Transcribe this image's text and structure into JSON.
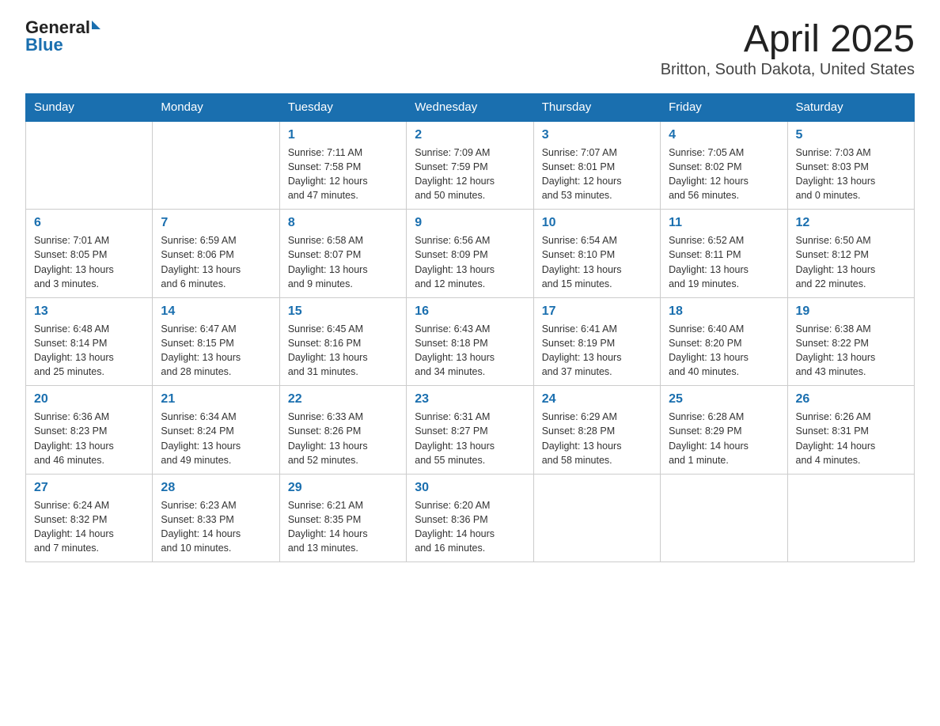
{
  "header": {
    "logo_general": "General",
    "logo_blue": "Blue",
    "title": "April 2025",
    "subtitle": "Britton, South Dakota, United States"
  },
  "weekdays": [
    "Sunday",
    "Monday",
    "Tuesday",
    "Wednesday",
    "Thursday",
    "Friday",
    "Saturday"
  ],
  "weeks": [
    [
      {
        "date": "",
        "info": ""
      },
      {
        "date": "",
        "info": ""
      },
      {
        "date": "1",
        "info": "Sunrise: 7:11 AM\nSunset: 7:58 PM\nDaylight: 12 hours\nand 47 minutes."
      },
      {
        "date": "2",
        "info": "Sunrise: 7:09 AM\nSunset: 7:59 PM\nDaylight: 12 hours\nand 50 minutes."
      },
      {
        "date": "3",
        "info": "Sunrise: 7:07 AM\nSunset: 8:01 PM\nDaylight: 12 hours\nand 53 minutes."
      },
      {
        "date": "4",
        "info": "Sunrise: 7:05 AM\nSunset: 8:02 PM\nDaylight: 12 hours\nand 56 minutes."
      },
      {
        "date": "5",
        "info": "Sunrise: 7:03 AM\nSunset: 8:03 PM\nDaylight: 13 hours\nand 0 minutes."
      }
    ],
    [
      {
        "date": "6",
        "info": "Sunrise: 7:01 AM\nSunset: 8:05 PM\nDaylight: 13 hours\nand 3 minutes."
      },
      {
        "date": "7",
        "info": "Sunrise: 6:59 AM\nSunset: 8:06 PM\nDaylight: 13 hours\nand 6 minutes."
      },
      {
        "date": "8",
        "info": "Sunrise: 6:58 AM\nSunset: 8:07 PM\nDaylight: 13 hours\nand 9 minutes."
      },
      {
        "date": "9",
        "info": "Sunrise: 6:56 AM\nSunset: 8:09 PM\nDaylight: 13 hours\nand 12 minutes."
      },
      {
        "date": "10",
        "info": "Sunrise: 6:54 AM\nSunset: 8:10 PM\nDaylight: 13 hours\nand 15 minutes."
      },
      {
        "date": "11",
        "info": "Sunrise: 6:52 AM\nSunset: 8:11 PM\nDaylight: 13 hours\nand 19 minutes."
      },
      {
        "date": "12",
        "info": "Sunrise: 6:50 AM\nSunset: 8:12 PM\nDaylight: 13 hours\nand 22 minutes."
      }
    ],
    [
      {
        "date": "13",
        "info": "Sunrise: 6:48 AM\nSunset: 8:14 PM\nDaylight: 13 hours\nand 25 minutes."
      },
      {
        "date": "14",
        "info": "Sunrise: 6:47 AM\nSunset: 8:15 PM\nDaylight: 13 hours\nand 28 minutes."
      },
      {
        "date": "15",
        "info": "Sunrise: 6:45 AM\nSunset: 8:16 PM\nDaylight: 13 hours\nand 31 minutes."
      },
      {
        "date": "16",
        "info": "Sunrise: 6:43 AM\nSunset: 8:18 PM\nDaylight: 13 hours\nand 34 minutes."
      },
      {
        "date": "17",
        "info": "Sunrise: 6:41 AM\nSunset: 8:19 PM\nDaylight: 13 hours\nand 37 minutes."
      },
      {
        "date": "18",
        "info": "Sunrise: 6:40 AM\nSunset: 8:20 PM\nDaylight: 13 hours\nand 40 minutes."
      },
      {
        "date": "19",
        "info": "Sunrise: 6:38 AM\nSunset: 8:22 PM\nDaylight: 13 hours\nand 43 minutes."
      }
    ],
    [
      {
        "date": "20",
        "info": "Sunrise: 6:36 AM\nSunset: 8:23 PM\nDaylight: 13 hours\nand 46 minutes."
      },
      {
        "date": "21",
        "info": "Sunrise: 6:34 AM\nSunset: 8:24 PM\nDaylight: 13 hours\nand 49 minutes."
      },
      {
        "date": "22",
        "info": "Sunrise: 6:33 AM\nSunset: 8:26 PM\nDaylight: 13 hours\nand 52 minutes."
      },
      {
        "date": "23",
        "info": "Sunrise: 6:31 AM\nSunset: 8:27 PM\nDaylight: 13 hours\nand 55 minutes."
      },
      {
        "date": "24",
        "info": "Sunrise: 6:29 AM\nSunset: 8:28 PM\nDaylight: 13 hours\nand 58 minutes."
      },
      {
        "date": "25",
        "info": "Sunrise: 6:28 AM\nSunset: 8:29 PM\nDaylight: 14 hours\nand 1 minute."
      },
      {
        "date": "26",
        "info": "Sunrise: 6:26 AM\nSunset: 8:31 PM\nDaylight: 14 hours\nand 4 minutes."
      }
    ],
    [
      {
        "date": "27",
        "info": "Sunrise: 6:24 AM\nSunset: 8:32 PM\nDaylight: 14 hours\nand 7 minutes."
      },
      {
        "date": "28",
        "info": "Sunrise: 6:23 AM\nSunset: 8:33 PM\nDaylight: 14 hours\nand 10 minutes."
      },
      {
        "date": "29",
        "info": "Sunrise: 6:21 AM\nSunset: 8:35 PM\nDaylight: 14 hours\nand 13 minutes."
      },
      {
        "date": "30",
        "info": "Sunrise: 6:20 AM\nSunset: 8:36 PM\nDaylight: 14 hours\nand 16 minutes."
      },
      {
        "date": "",
        "info": ""
      },
      {
        "date": "",
        "info": ""
      },
      {
        "date": "",
        "info": ""
      }
    ]
  ]
}
